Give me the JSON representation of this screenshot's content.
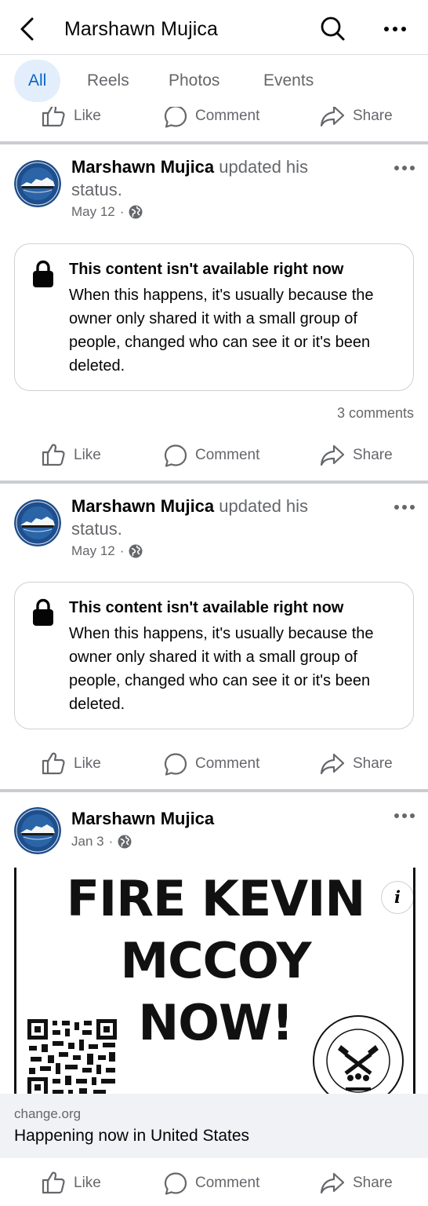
{
  "header": {
    "title": "Marshawn Mujica",
    "back_icon": "back-arrow-icon",
    "search_icon": "search-icon",
    "more_icon": "more-horizontal-icon"
  },
  "tabs": [
    {
      "label": "All",
      "active": true
    },
    {
      "label": "Reels",
      "active": false
    },
    {
      "label": "Photos",
      "active": false
    },
    {
      "label": "Events",
      "active": false
    }
  ],
  "actions": {
    "like": "Like",
    "comment": "Comment",
    "share": "Share"
  },
  "posts": [
    {
      "author": "Marshawn Mujica",
      "action": "updated his status.",
      "date": "May 12",
      "dot": "·",
      "audience_icon": "globe-icon",
      "unavailable_title": "This content isn't available right now",
      "unavailable_body": "When this happens, it's usually because the owner only shared it with a small group of people, changed who can see it or it's been deleted.",
      "comments": "3 comments"
    },
    {
      "author": "Marshawn Mujica",
      "action": "updated his status.",
      "date": "May 12",
      "dot": "·",
      "audience_icon": "globe-icon",
      "unavailable_title": "This content isn't available right now",
      "unavailable_body": "When this happens, it's usually because the owner only shared it with a small group of people, changed who can see it or it's been deleted."
    },
    {
      "author": "Marshawn Mujica",
      "date": "Jan 3",
      "dot": "·",
      "audience_icon": "globe-icon",
      "image_headline": [
        "FIRE KEVIN",
        "MCCOY",
        "NOW!"
      ],
      "info_glyph": "i",
      "link_domain": "change.org",
      "link_title": "Happening now in United States"
    }
  ],
  "colors": {
    "accent": "#0866c6",
    "accent_bg": "#e3eefc",
    "secondary_text": "#65676b",
    "separator": "#c9ccd1"
  }
}
